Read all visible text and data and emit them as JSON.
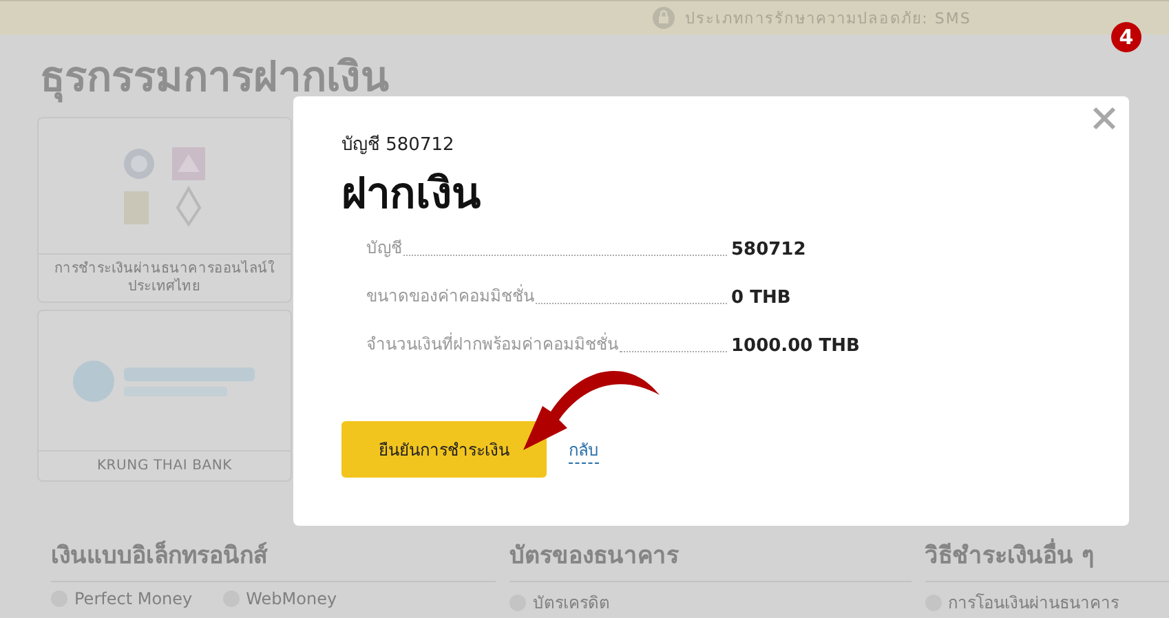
{
  "security_bar": {
    "text": "ประเภทการรักษาความปลอดภัย: SMS"
  },
  "step_badge": "4",
  "page_title": "ธุรกรรมการฝากเงิน",
  "payment_cards": [
    {
      "kind": "bank_group",
      "caption_lines": [
        "การชำระเงินผ่านธนาคารออนไลน์ใ",
        "ประเทศไทย"
      ]
    },
    {
      "kind": "single_bank",
      "caption_lines": [
        "KRUNG THAI BANK"
      ]
    }
  ],
  "sections": [
    {
      "title": "เงินแบบอิเล็กทรอนิกส์",
      "items": [
        "Perfect Money",
        "WebMoney"
      ]
    },
    {
      "title": "บัตรของธนาคาร",
      "items": [
        "บัตรเครดิต"
      ]
    },
    {
      "title": "วิธีชำระเงินอื่น ๆ",
      "items": [
        "การโอนเงินผ่านธนาคาร"
      ]
    }
  ],
  "dialog": {
    "account_caption": "บัญชี 580712",
    "title": "ฝากเงิน",
    "rows": [
      {
        "label": "บัญชี",
        "value": "580712"
      },
      {
        "label": "ขนาดของค่าคอมมิชชั่น",
        "value": "0 THB"
      },
      {
        "label": "จำนวนเงินที่ฝากพร้อมค่าคอมมิชชั่น",
        "value": "1000.00 THB"
      }
    ],
    "confirm_button": "ยืนยันการชำระเงิน",
    "back_link": "กลับ"
  }
}
